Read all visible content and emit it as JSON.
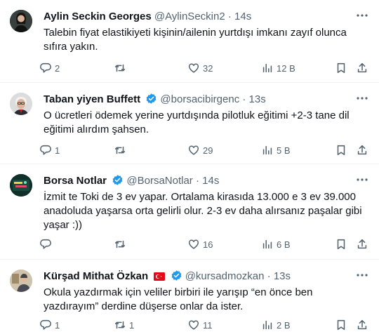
{
  "tweets": [
    {
      "name": "Aylin Seckin Georges",
      "handle": "@AylinSeckin2",
      "time": "14s",
      "text": "Talebin fiyat elastikiyeti kişinin/ailenin yurtdışı imkanı zayıf olunca sıfıra yakın.",
      "replies": "2",
      "retweets": "",
      "likes": "32",
      "views": "12 B",
      "verified": false,
      "flag": false
    },
    {
      "name": "Taban yiyen Buffett",
      "handle": "@borsacibirgenc",
      "time": "13s",
      "text": "O ücretleri ödemek yerine yurtdışında pilotluk eğitimi  +2-3 tane dil eğitimi alırdım şahsen.",
      "replies": "1",
      "retweets": "",
      "likes": "29",
      "views": "5 B",
      "verified": true,
      "flag": false
    },
    {
      "name": "Borsa Notlar",
      "handle": "@BorsaNotlar",
      "time": "14s",
      "text": "İzmit te Toki de 3 ev yapar. Ortalama kirasıda 13.000 e 3 ev 39.000 anadoluda yaşarsa orta gelirli olur. 2-3 ev daha alırsanız paşalar gibi yaşar :))",
      "replies": "",
      "retweets": "",
      "likes": "16",
      "views": "6 B",
      "verified": true,
      "flag": false
    },
    {
      "name": "Kürşad Mithat Özkan",
      "handle": "@kursadmozkan",
      "time": "13s",
      "text": "Okula yazdırmak için veliler birbiri ile yarışıp “en önce ben yazdırayım” derdine düşerse onlar da ister.",
      "replies": "1",
      "retweets": "1",
      "likes": "11",
      "views": "2 B",
      "verified": true,
      "flag": true
    }
  ],
  "dot": "·",
  "colors": {
    "verified": "#1d9bf0",
    "muted": "#536471",
    "text": "#0f1419",
    "border": "#eff3f4"
  }
}
